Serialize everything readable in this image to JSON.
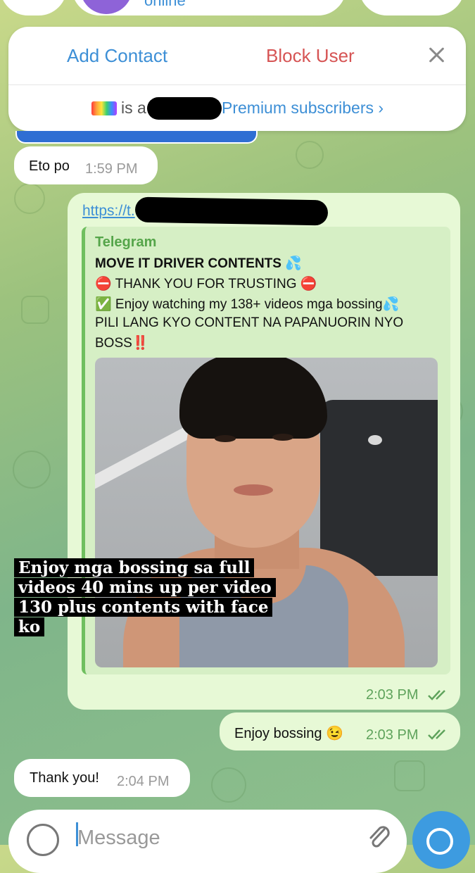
{
  "header": {
    "status_text": "online"
  },
  "action_panel": {
    "add_contact_label": "Add Contact",
    "block_user_label": "Block User",
    "premium_prefix": "is a",
    "premium_link": "Premium subscribers ›"
  },
  "messages": [
    {
      "direction": "in",
      "text": "Eto po",
      "time": "1:59 PM"
    },
    {
      "direction": "out",
      "link": "https://t.",
      "preview": {
        "site": "Telegram",
        "title": "MOVE IT DRIVER CONTENTS 💦",
        "lines": [
          "⛔ THANK YOU FOR TRUSTING ⛔",
          "✅ Enjoy watching my 138+ videos mga bossing💦",
          "PILI  LANG KYO CONTENT NA PAPANUORIN NYO",
          "BOSS‼️"
        ],
        "image_caption": [
          "Enjoy mga bossing sa full",
          "videos 40 mins up per video",
          "130 plus contents with face",
          "ko"
        ]
      },
      "time": "2:03 PM"
    },
    {
      "direction": "out",
      "text": "Enjoy bossing 😉",
      "time": "2:03 PM"
    },
    {
      "direction": "in",
      "text": "Thank you!",
      "time": "2:04 PM"
    }
  ],
  "composer": {
    "placeholder": "Message"
  },
  "colors": {
    "accent": "#3d8fd6",
    "danger": "#d65454",
    "outgoing_bubble": "#e7f9d6",
    "send_button": "#3d9be0"
  }
}
